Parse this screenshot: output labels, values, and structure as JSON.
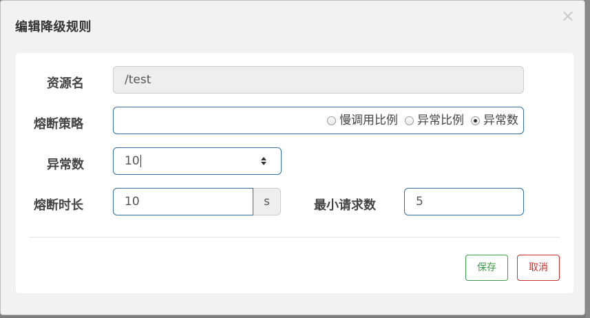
{
  "dialog": {
    "title": "编辑降级规则",
    "close_glyph": "×"
  },
  "form": {
    "resource": {
      "label": "资源名",
      "value": "/test"
    },
    "strategy": {
      "label": "熔断策略",
      "options": [
        {
          "label": "慢调用比例",
          "checked": false
        },
        {
          "label": "异常比例",
          "checked": false
        },
        {
          "label": "异常数",
          "checked": true
        }
      ]
    },
    "exception_count": {
      "label": "异常数",
      "value": "10"
    },
    "break_duration": {
      "label": "熔断时长",
      "value": "10",
      "unit": "s"
    },
    "min_requests": {
      "label": "最小请求数",
      "value": "5"
    }
  },
  "footer": {
    "save_label": "保存",
    "cancel_label": "取消"
  },
  "colors": {
    "save": "#3c9a4d",
    "cancel": "#c9302c",
    "input_border": "#2f6fa6"
  }
}
